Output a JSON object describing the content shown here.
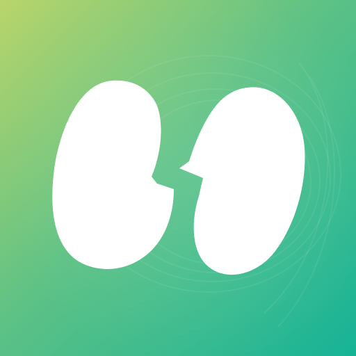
{
  "app_icon": {
    "colors": {
      "gradient_start": "#b9d56a",
      "gradient_mid": "#5fc285",
      "gradient_end": "#16b397",
      "swirl": "#ffffff",
      "glyph": "#ffffff"
    },
    "glyph_icon": "twin-quote-bubbles-icon"
  }
}
